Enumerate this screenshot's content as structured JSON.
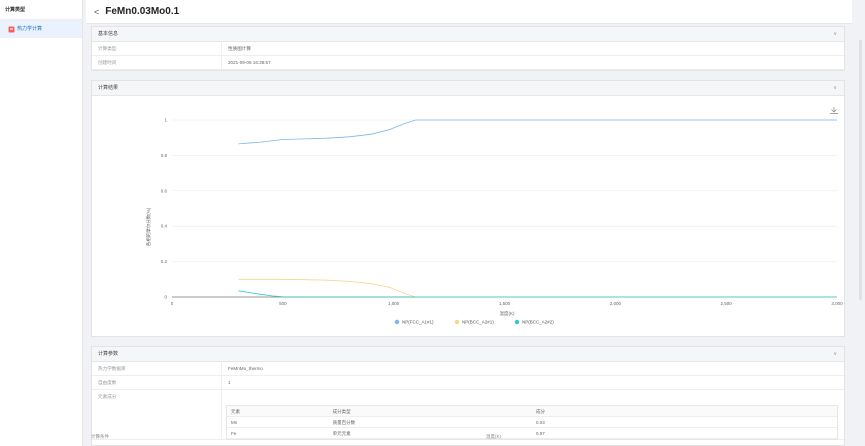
{
  "sidebar": {
    "header": "计算类型",
    "items": [
      {
        "label": "热力学计算",
        "icon": "document-icon"
      }
    ]
  },
  "header": {
    "back_icon": "<",
    "title": "FeMn0.03Mo0.1"
  },
  "basic_info": {
    "title": "基本信息",
    "rows": [
      {
        "key": "计算类型",
        "value": "性质图计算"
      },
      {
        "key": "创建时间",
        "value": "2021-09-06 16:38:57"
      }
    ]
  },
  "results": {
    "title": "计算结果",
    "download_icon": "download-icon"
  },
  "params": {
    "title": "计算参数",
    "rows": [
      {
        "key": "热力学数据库",
        "value": "FeMnMo_thermo"
      },
      {
        "key": "自由度数",
        "value": "1"
      },
      {
        "key": "元素成分",
        "value": ""
      }
    ],
    "composition": {
      "headers": [
        "元素",
        "成分类型",
        "成分"
      ],
      "rows": [
        [
          "Mn",
          "质量百分数",
          "0.03"
        ],
        [
          "Fe",
          "单元元素",
          "0.97"
        ]
      ]
    },
    "bottom_label": "温度(K)",
    "bottom_label_left": "计算条件"
  },
  "chart_data": {
    "type": "line",
    "xlabel": "温度(K)",
    "ylabel": "各相的摩尔分数(%)",
    "xlim": [
      0,
      3000
    ],
    "ylim": [
      0,
      1
    ],
    "xticks": [
      "0",
      "500",
      "1,000",
      "1,500",
      "2,000",
      "2,500",
      "3,000"
    ],
    "yticks": [
      "0",
      "0.2",
      "0.4",
      "0.6",
      "0.8",
      "1"
    ],
    "legend_position": "bottom",
    "series": [
      {
        "name": "NP(FCC_A1#1)",
        "color": "#7cb5ec",
        "x": [
          300,
          400,
          500,
          600,
          700,
          800,
          900,
          980,
          1050,
          1100,
          1500,
          2000,
          2500,
          3000
        ],
        "y": [
          0.865,
          0.875,
          0.89,
          0.893,
          0.897,
          0.905,
          0.92,
          0.945,
          0.98,
          1,
          1,
          1,
          1,
          1
        ]
      },
      {
        "name": "NP(BCC_A2#1)",
        "color": "#f7d58b",
        "x": [
          300,
          400,
          500,
          600,
          700,
          800,
          900,
          980,
          1050,
          1100,
          1500,
          2000,
          2500,
          3000
        ],
        "y": [
          0.1,
          0.1,
          0.1,
          0.098,
          0.095,
          0.088,
          0.075,
          0.055,
          0.02,
          0,
          0,
          0,
          0,
          0
        ]
      },
      {
        "name": "NP(BCC_A2#2)",
        "color": "#2ec7c9",
        "x": [
          300,
          350,
          400,
          450,
          500,
          600,
          1000,
          1500,
          2000,
          2500,
          3000
        ],
        "y": [
          0.035,
          0.025,
          0.015,
          0.006,
          0.001,
          0,
          0,
          0,
          0,
          0,
          0
        ]
      }
    ]
  }
}
